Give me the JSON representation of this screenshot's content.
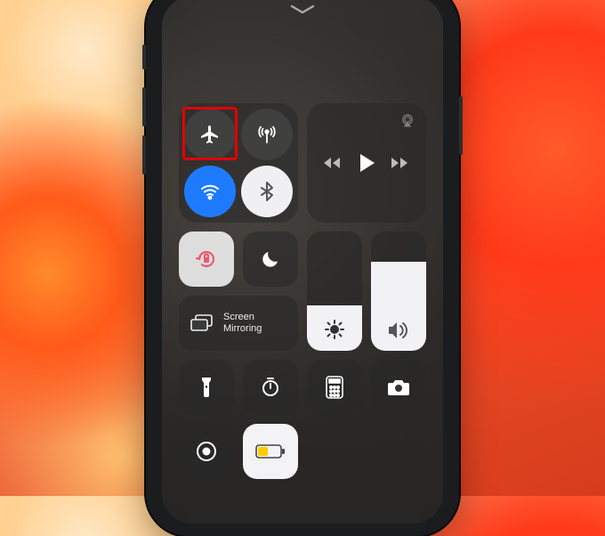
{
  "screen_mirroring_label": "Screen\nMirroring",
  "toggles": {
    "airplane_mode": {
      "on": false,
      "highlighted": true
    },
    "cellular_data": {
      "on": false
    },
    "wifi": {
      "on": true
    },
    "bluetooth": {
      "on": true
    },
    "orientation_lock": {
      "on": false
    },
    "do_not_disturb": {
      "on": false
    },
    "low_power_mode": {
      "on": true
    }
  },
  "sliders": {
    "brightness_percent": 38,
    "volume_percent": 75
  },
  "colors": {
    "wifi_on": "#1e7bff",
    "highlight_box": "#e30000",
    "orientation_lock_icon": "#e85a6e",
    "low_power_battery": "#ffcc00"
  },
  "icons": {
    "chevron": "chevron-down-icon",
    "airplane": "airplane-icon",
    "cellular": "cellular-antenna-icon",
    "wifi": "wifi-icon",
    "bluetooth": "bluetooth-icon",
    "airplay": "airplay-icon",
    "prev": "previous-track-icon",
    "play": "play-icon",
    "next": "next-track-icon",
    "orientation_lock": "orientation-lock-icon",
    "do_not_disturb": "moon-icon",
    "screen_mirroring": "screen-mirroring-icon",
    "brightness": "sun-icon",
    "volume": "speaker-icon",
    "flashlight": "flashlight-icon",
    "timer": "timer-icon",
    "calculator": "calculator-icon",
    "camera": "camera-icon",
    "screen_record": "screen-record-icon",
    "battery": "battery-icon"
  }
}
